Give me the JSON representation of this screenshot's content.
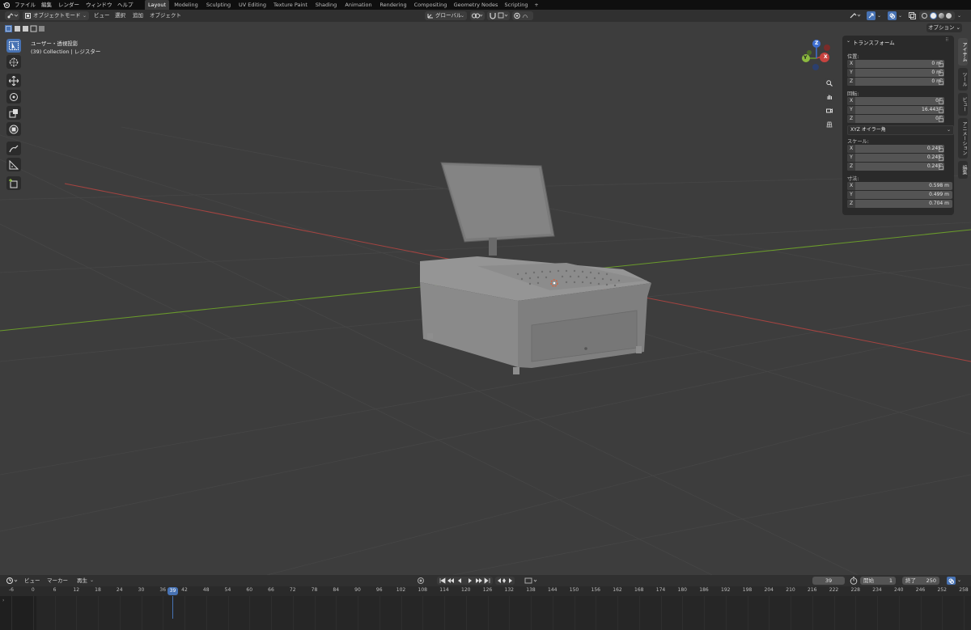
{
  "topbar": {
    "menus": [
      "ファイル",
      "編集",
      "レンダー",
      "ウィンドウ",
      "ヘルプ"
    ],
    "workspaces": [
      "Layout",
      "Modeling",
      "Sculpting",
      "UV Editing",
      "Texture Paint",
      "Shading",
      "Animation",
      "Rendering",
      "Compositing",
      "Geometry Nodes",
      "Scripting"
    ],
    "active_workspace": "Layout",
    "add_tab": "+"
  },
  "header": {
    "mode": "オブジェクトモード",
    "menus": [
      "ビュー",
      "選択",
      "追加",
      "オブジェクト"
    ],
    "transform_orientation": "グローバル",
    "options": "オプション"
  },
  "viewport": {
    "view_label": "ユーザー・透視投影",
    "collection_label": "(39) Collection | レジスター",
    "gizmo": {
      "x": "X",
      "y": "Y",
      "z": "Z"
    }
  },
  "npanel": {
    "title": "トランスフォーム",
    "location_label": "位置:",
    "location": [
      {
        "axis": "X",
        "value": "0 m"
      },
      {
        "axis": "Y",
        "value": "0 m"
      },
      {
        "axis": "Z",
        "value": "0 m"
      }
    ],
    "rotation_label": "回転:",
    "rotation": [
      {
        "axis": "X",
        "value": "0°"
      },
      {
        "axis": "Y",
        "value": "16.443°"
      },
      {
        "axis": "Z",
        "value": "0°"
      }
    ],
    "rotation_mode": "XYZ オイラー角",
    "scale_label": "スケール:",
    "scale": [
      {
        "axis": "X",
        "value": "0.245"
      },
      {
        "axis": "Y",
        "value": "0.245"
      },
      {
        "axis": "Z",
        "value": "0.245"
      }
    ],
    "dimensions_label": "寸法:",
    "dimensions": [
      {
        "axis": "X",
        "value": "0.598 m"
      },
      {
        "axis": "Y",
        "value": "0.499 m"
      },
      {
        "axis": "Z",
        "value": "0.704 m"
      }
    ],
    "side_tabs": [
      "アイテム",
      "ツール",
      "ビュー",
      "アニメーション",
      "編集"
    ]
  },
  "timeline": {
    "menus": [
      "ビュー",
      "マーカー",
      "再生"
    ],
    "current_frame": "39",
    "start_label": "開始",
    "start": "1",
    "end_label": "終了",
    "end": "250",
    "ticks": [
      "-6",
      "0",
      "6",
      "12",
      "18",
      "24",
      "30",
      "36",
      "42",
      "48",
      "54",
      "60",
      "66",
      "72",
      "78",
      "84",
      "90",
      "96",
      "102",
      "108",
      "114",
      "120",
      "126",
      "132",
      "138",
      "144",
      "150",
      "156",
      "162",
      "168",
      "174",
      "180",
      "186",
      "192",
      "198",
      "204",
      "210",
      "216",
      "222",
      "228",
      "234",
      "240",
      "246",
      "252",
      "258"
    ]
  },
  "colors": {
    "accent": "#4772b3",
    "x_axis": "#c7433f",
    "y_axis": "#6a9b2b",
    "z_axis": "#3f6fd1"
  }
}
